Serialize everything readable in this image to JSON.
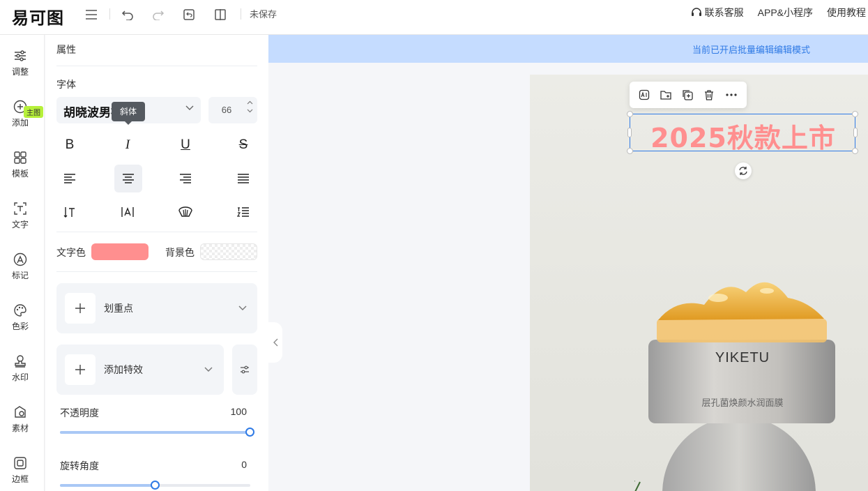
{
  "app": {
    "logo": "易可图",
    "save_status": "未保存"
  },
  "top_links": [
    "联系客服",
    "APP&小程序",
    "使用教程"
  ],
  "rail": [
    {
      "label": "调整",
      "icon": "sliders-icon"
    },
    {
      "label": "添加",
      "icon": "plus-circle-icon"
    },
    {
      "label": "模板",
      "icon": "grid-icon"
    },
    {
      "label": "文字",
      "icon": "text-icon"
    },
    {
      "label": "标记",
      "icon": "marker-icon"
    },
    {
      "label": "色彩",
      "icon": "palette-icon"
    },
    {
      "label": "水印",
      "icon": "stamp-icon"
    },
    {
      "label": "素材",
      "icon": "material-icon"
    },
    {
      "label": "边框",
      "icon": "frame-icon"
    }
  ],
  "rail_badge": "主图",
  "panel": {
    "title": "属性",
    "font_section": "字体",
    "font_name": "胡晓波男神体",
    "font_size": "66",
    "tooltip": "斜体",
    "text_color_label": "文字色",
    "text_color": "#ff8f8f",
    "bg_color_label": "背景色",
    "highlight_label": "划重点",
    "effect_label": "添加特效",
    "opacity_label": "不透明度",
    "opacity_value": "100",
    "rotation_label": "旋转角度",
    "rotation_value": "0"
  },
  "canvas": {
    "banner": "当前已开启批量编辑编辑模式",
    "headline": "2025秋款上市",
    "jar_brand": "YIKETU",
    "jar_subtitle": "层孔菌焕颜水润面膜"
  }
}
